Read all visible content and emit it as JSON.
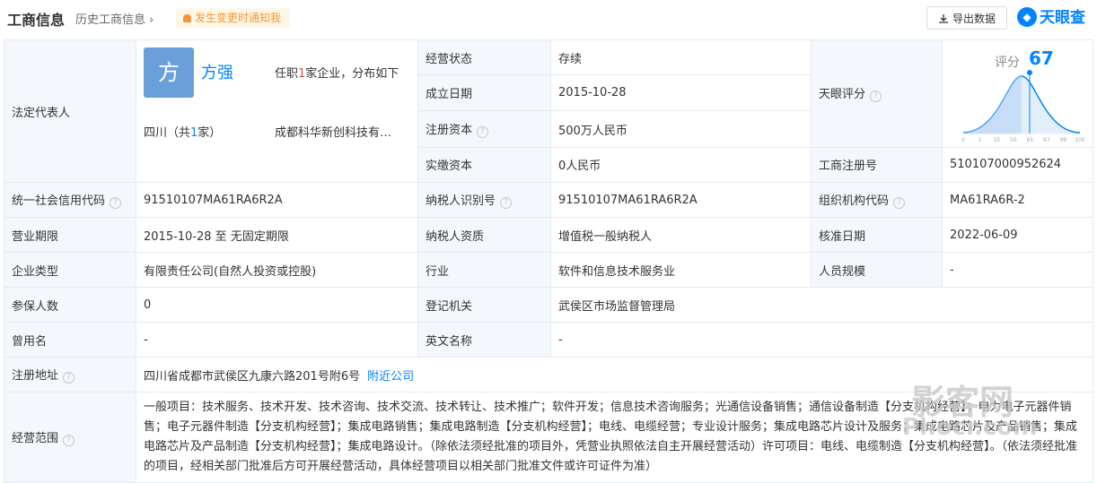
{
  "header": {
    "title": "工商信息",
    "history_link": "历史工商信息",
    "notify_label": "发生变更时通知我",
    "export_label": "导出数据",
    "logo_text": "天眼查"
  },
  "legal_rep": {
    "label": "法定代表人",
    "avatar_char": "方",
    "name": "方强",
    "role_prefix": "任职",
    "role_count": "1",
    "role_suffix": "家企业，分布如下",
    "region_prefix": "四川（共",
    "region_count": "1",
    "region_suffix": "家）",
    "company": "成都科华新创科技有…"
  },
  "rows": {
    "status": {
      "label": "经营状态",
      "value": "存续"
    },
    "founded": {
      "label": "成立日期",
      "value": "2015-10-28"
    },
    "capital": {
      "label": "注册资本",
      "value": "500万人民币"
    },
    "paid": {
      "label": "实缴资本",
      "value": "0人民币"
    },
    "reg_no": {
      "label": "工商注册号",
      "value": "510107000952624"
    },
    "credit_code": {
      "label": "统一社会信用代码",
      "value": "91510107MA61RA6R2A"
    },
    "taxpayer_id": {
      "label": "纳税人识别号",
      "value": "91510107MA61RA6R2A"
    },
    "org_code": {
      "label": "组织机构代码",
      "value": "MA61RA6R-2"
    },
    "term": {
      "label": "营业期限",
      "value": "2015-10-28 至 无固定期限"
    },
    "taxpayer_type": {
      "label": "纳税人资质",
      "value": "增值税一般纳税人"
    },
    "approve_date": {
      "label": "核准日期",
      "value": "2022-06-09"
    },
    "company_type": {
      "label": "企业类型",
      "value": "有限责任公司(自然人投资或控股)"
    },
    "industry": {
      "label": "行业",
      "value": "软件和信息技术服务业"
    },
    "staff_size": {
      "label": "人员规模",
      "value": "-"
    },
    "insured": {
      "label": "参保人数",
      "value": "0"
    },
    "authority": {
      "label": "登记机关",
      "value": "武侯区市场监督管理局"
    },
    "former_name": {
      "label": "曾用名",
      "value": "-"
    },
    "english_name": {
      "label": "英文名称",
      "value": "-"
    },
    "address": {
      "label": "注册地址",
      "value": "四川省成都市武侯区九康六路201号附6号",
      "link": "附近公司"
    },
    "scope": {
      "label": "经营范围",
      "value": "一般项目：技术服务、技术开发、技术咨询、技术交流、技术转让、技术推广；软件开发；信息技术咨询服务；光通信设备销售；通信设备制造【分支机构经营】；电力电子元器件销售；电子元器件制造【分支机构经营】；集成电路销售；集成电路制造【分支机构经营】；电线、电缆经营；专业设计服务；集成电路芯片设计及服务；集成电路芯片及产品销售；集成电路芯片及产品制造【分支机构经营】；集成电路设计。（除依法须经批准的项目外，凭营业执照依法自主开展经营活动）许可项目：电线、电缆制造【分支机构经营】。（依法须经批准的项目，经相关部门批准后方可开展经营活动，具体经营项目以相关部门批准文件或许可证件为准）"
    }
  },
  "score": {
    "label": "天眼评分",
    "caption": "评分",
    "value": "67",
    "level": 67,
    "ticks": [
      "0",
      "1",
      "15",
      "50",
      "65",
      "97",
      "99",
      "100"
    ]
  },
  "watermark": {
    "line1": "影客网",
    "line2": "Phocr.com"
  },
  "icons": {
    "question": "question-icon",
    "bell": "bell-icon",
    "download": "download-icon",
    "chevron": "chevron-right-icon"
  },
  "colors": {
    "accent": "#0084ff",
    "label_bg": "#f4f8fd",
    "notify_text": "#f4953b",
    "highlight": "#f0473e"
  }
}
